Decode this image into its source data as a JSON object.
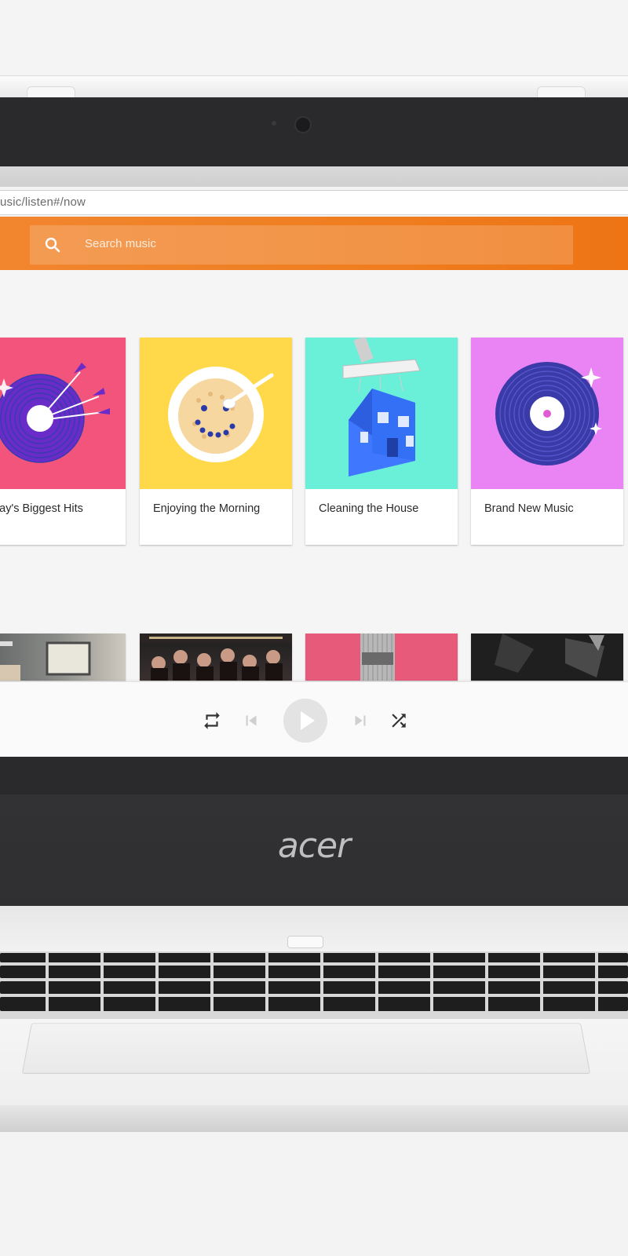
{
  "browser": {
    "url": "usic/listen#/now"
  },
  "app": {
    "search_placeholder": "Search music",
    "accent_color": "#ef7d1f"
  },
  "playlists": [
    {
      "title": "oday's Biggest Hits",
      "color": "#f2547c"
    },
    {
      "title": "Enjoying the Morning",
      "color": "#ffd94a"
    },
    {
      "title": "Cleaning the House",
      "color": "#6af0d8"
    },
    {
      "title": "Brand New Music",
      "color": "#ea83f3"
    }
  ],
  "player": {
    "controls": [
      "repeat-icon",
      "skip-previous-icon",
      "play-icon",
      "skip-next-icon",
      "shuffle-icon"
    ]
  },
  "device": {
    "brand": "acer"
  }
}
